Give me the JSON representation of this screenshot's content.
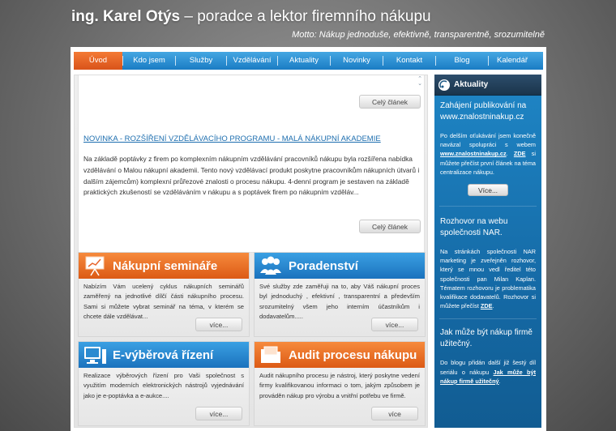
{
  "header": {
    "name": "ing. Karel Otýs",
    "subtitle": " – poradce a lektor firemního nákupu",
    "motto": "Motto: Nákup jednoduše,  efektivně, transparentně, srozumitelně"
  },
  "nav": {
    "items": [
      {
        "label": "Úvod"
      },
      {
        "label": "Kdo jsem"
      },
      {
        "label": "Služby"
      },
      {
        "label": "Vzdělávání"
      },
      {
        "label": "Aktuality"
      },
      {
        "label": "Novinky"
      },
      {
        "label": "Kontakt"
      },
      {
        "label": "Blog"
      },
      {
        "label": "Kalendář"
      }
    ]
  },
  "article": {
    "more_label": "Celý článek",
    "title": "NOVINKA - ROZŠÍŘENÍ VZDĚLÁVACÍHO PROGRAMU - MALÁ NÁKUPNÍ AKADEMIE",
    "text": "Na základě poptávky z firem po komplexním nákupním vzdělávání pracovníků nákupu byla rozšířena nabídka vzdělávání o Malou nákupní akademii. Tento nový vzdělávací produkt poskytne pracovníkům nákupních útvarů i  dalším zájemcům) komplexní průřezové znalosti  o procesu nákupu. 4-denní program je sestaven na základě praktických zkušeností se vzděláváním v nákupu a s poptávek firem po nákupním vzděláv..."
  },
  "tiles": [
    {
      "title": "Nákupní semináře",
      "color": "orange",
      "icon": "presentation-icon",
      "text": "Nabízím Vám ucelený cyklus nákupních seminářů zaměřený na jednotlivé dílčí části nákupního procesu. Sami si můžete vybrat seminář na téma, v kterém se chcete dále vzdělávat...",
      "button": "více..."
    },
    {
      "title": "Poradenství",
      "color": "blue",
      "icon": "people-icon",
      "text": "Své služby zde zaměřuji na to, aby Váš nákupní proces byl jednoduchý , efektivní , transparentní a především srozumitelný všem jeho interním účastníkům i dodavatelům.....",
      "button": "více..."
    },
    {
      "title": "E-výběrová řízení",
      "color": "blue",
      "icon": "computer-icon",
      "text": "Realizace výběrových řízení pro Vaši společnost s využitím moderních elektronických nástrojů vyjednávání jako je e-poptávka a e-aukce....",
      "button": "více..."
    },
    {
      "title": "Audit procesu nákupu",
      "color": "orange",
      "icon": "folder-icon",
      "text": "Audit nákupního procesu je nástroj, který poskytne vedení firmy kvalifikovanou informaci o tom, jakým způsobem je prováděn nákup pro výrobu a vnitřní potřebu ve firmě.",
      "button": "více"
    }
  ],
  "sidebar": {
    "heading": "Aktuality",
    "news1": {
      "title": "Zahájení publikování na www.znalostninakup.cz",
      "p1": "Po delším oťukávání jsem konečně navázal spolupráci s webem ",
      "link1": "www.znalostninakup.cz",
      "p2": ". ",
      "link2": "ZDE",
      "p3": " si můžete přečíst první článek na téma centralizace nákupu.",
      "button": "Více..."
    },
    "news2": {
      "title": "Rozhovor na webu společnosti NAR.",
      "p1": "Na stránkách společnosti NAR marketing je zveřejněn rozhovor, který se mnou vedl ředitel této společnosti pan Milan Kaplan. Tématem rozhovoru je problematika kvalifikace dodavatelů. Rozhovor si můžete přečíst ",
      "link1": "ZDE",
      "p2": "."
    },
    "news3": {
      "title": "Jak může být nákup firmě užitečný.",
      "p1": "Do blogu přidán další již šestý díl seriálu o nákupu ",
      "link1": "Jak může být nákup firmě užitečný",
      "p2": "."
    }
  },
  "colors": {
    "accent_orange": "#e8642a",
    "accent_blue": "#1f86c6",
    "link": "#1d6eaf"
  }
}
